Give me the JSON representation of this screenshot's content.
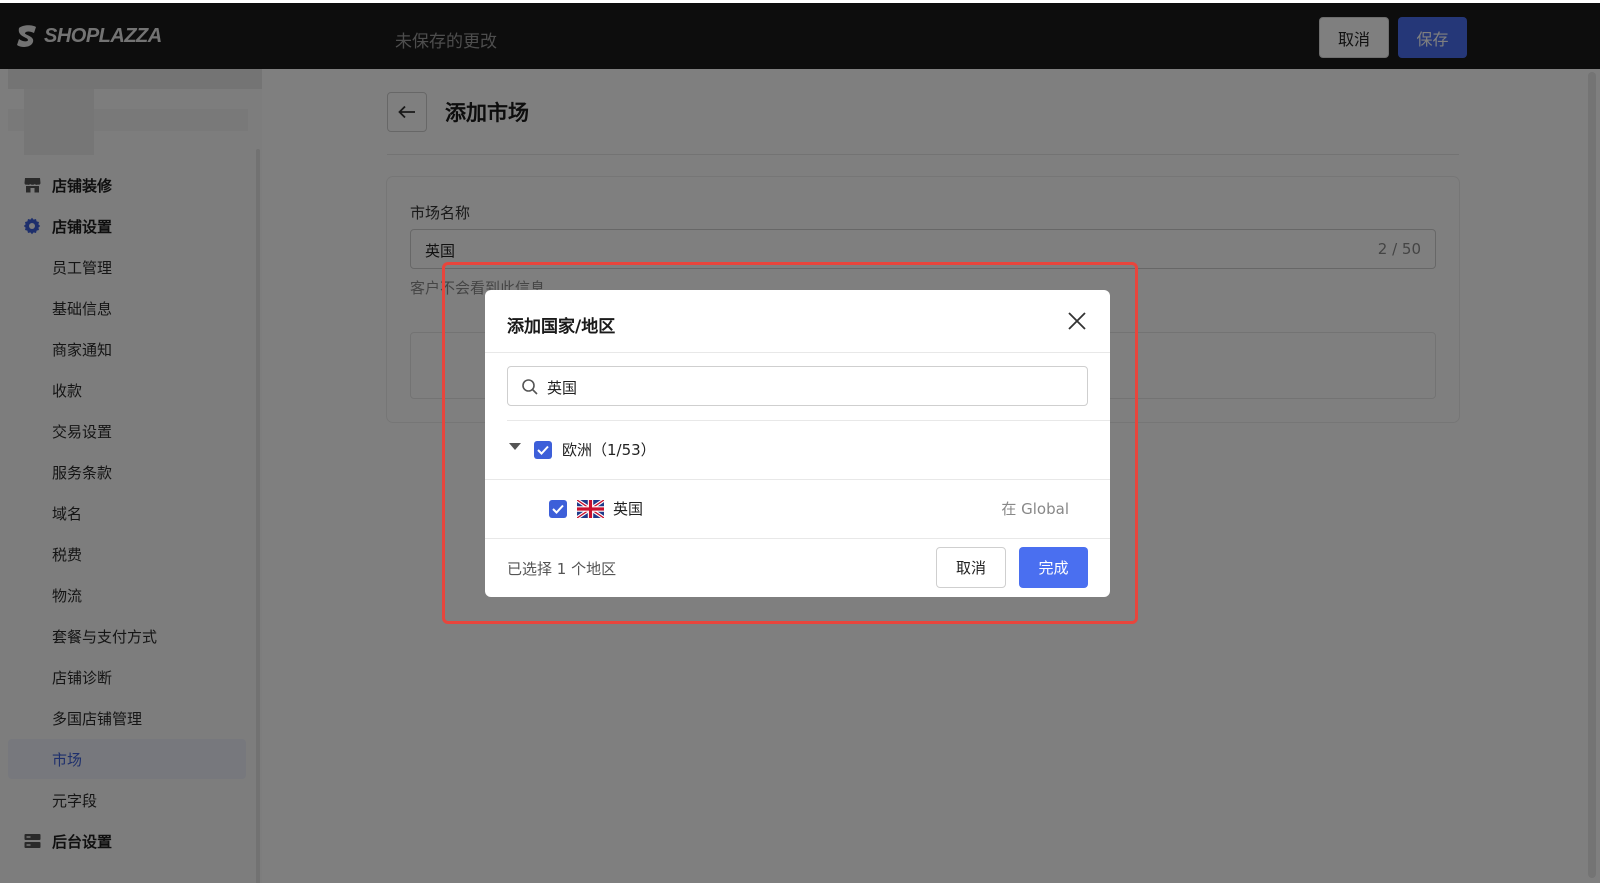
{
  "app": {
    "logo_text": "SHOPLAZZA",
    "unsaved_text": "未保存的更改",
    "cancel_label": "取消",
    "save_label": "保存",
    "accent_color": "#4a6ff0"
  },
  "sidebar": {
    "items": [
      {
        "label": "店铺装修",
        "icon": "store-icon"
      },
      {
        "label": "店铺设置",
        "icon": "gear-icon"
      },
      {
        "label": "员工管理"
      },
      {
        "label": "基础信息"
      },
      {
        "label": "商家通知"
      },
      {
        "label": "收款"
      },
      {
        "label": "交易设置"
      },
      {
        "label": "服务条款"
      },
      {
        "label": "域名"
      },
      {
        "label": "税费"
      },
      {
        "label": "物流"
      },
      {
        "label": "套餐与支付方式"
      },
      {
        "label": "店铺诊断"
      },
      {
        "label": "多国店铺管理"
      },
      {
        "label": "市场"
      },
      {
        "label": "元字段"
      },
      {
        "label": "后台设置",
        "icon": "server-icon"
      }
    ],
    "active": "市场"
  },
  "page": {
    "title": "添加市场",
    "field_label": "市场名称",
    "field_value": "英国",
    "field_counter": "2 / 50",
    "field_help": "客户不会看到此信息"
  },
  "modal": {
    "title": "添加国家/地区",
    "search_value": "英国",
    "group_label": "欧洲（1/53）",
    "country_label": "英国",
    "country_market": "在 Global",
    "selected_count": "已选择 1 个地区",
    "cancel_label": "取消",
    "done_label": "完成"
  }
}
